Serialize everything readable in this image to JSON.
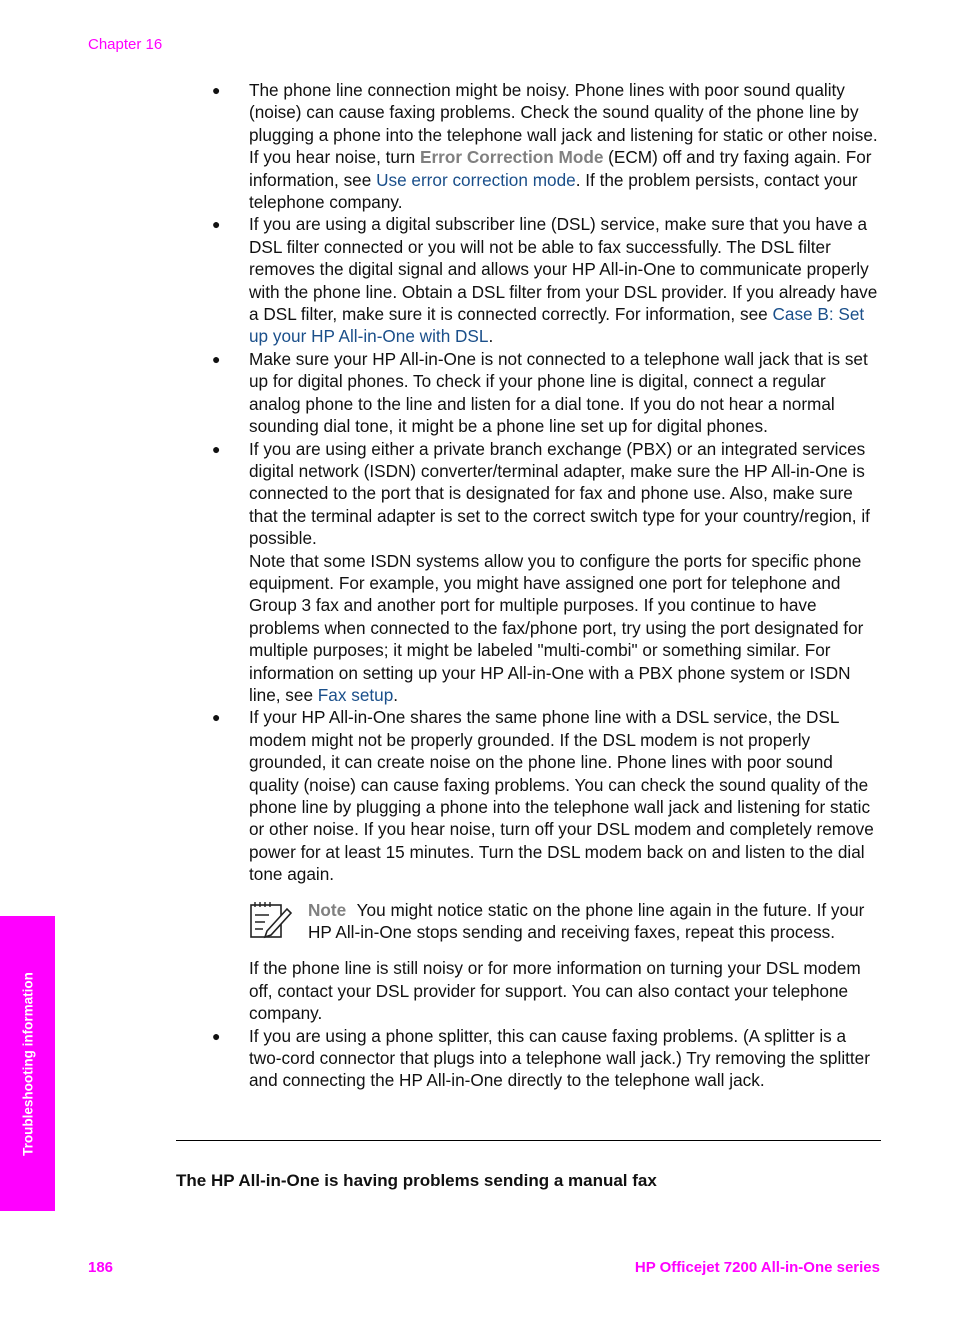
{
  "header": {
    "chapter": "Chapter 16"
  },
  "bullets": [
    {
      "pre": "The phone line connection might be noisy. Phone lines with poor sound quality (noise) can cause faxing problems. Check the sound quality of the phone line by plugging a phone into the telephone wall jack and listening for static or other noise. If you hear noise, turn ",
      "ui_term": "Error Correction Mode",
      "mid": " (ECM) off and try faxing again. For information, see ",
      "link": "Use error correction mode",
      "post": ". If the problem persists, contact your telephone company."
    },
    {
      "pre": "If you are using a digital subscriber line (DSL) service, make sure that you have a DSL filter connected or you will not be able to fax successfully. The DSL filter removes the digital signal and allows your HP All-in-One to communicate properly with the phone line. Obtain a DSL filter from your DSL provider. If you already have a DSL filter, make sure it is connected correctly. For information, see ",
      "link": "Case B: Set up your HP All-in-One with DSL",
      "post": "."
    },
    {
      "text": "Make sure your HP All-in-One is not connected to a telephone wall jack that is set up for digital phones. To check if your phone line is digital, connect a regular analog phone to the line and listen for a dial tone. If you do not hear a normal sounding dial tone, it might be a phone line set up for digital phones."
    },
    {
      "text": "If you are using either a private branch exchange (PBX) or an integrated services digital network (ISDN) converter/terminal adapter, make sure the HP All-in-One is connected to the port that is designated for fax and phone use. Also, make sure that the terminal adapter is set to the correct switch type for your country/region, if possible.",
      "para2_pre": "Note that some ISDN systems allow you to configure the ports for specific phone equipment. For example, you might have assigned one port for telephone and Group 3 fax and another port for multiple purposes. If you continue to have problems when connected to the fax/phone port, try using the port designated for multiple purposes; it might be labeled \"multi-combi\" or something similar. For information on setting up your HP All-in-One with a PBX phone system or ISDN line, see ",
      "link": "Fax setup",
      "post": "."
    },
    {
      "text": "If your HP All-in-One shares the same phone line with a DSL service, the DSL modem might not be properly grounded. If the DSL modem is not properly grounded, it can create noise on the phone line. Phone lines with poor sound quality (noise) can cause faxing problems. You can check the sound quality of the phone line by plugging a phone into the telephone wall jack and listening for static or other noise. If you hear noise, turn off your DSL modem and completely remove power for at least 15 minutes. Turn the DSL modem back on and listen to the dial tone again.",
      "note_label": "Note",
      "note_text": "You might notice static on the phone line again in the future. If your HP All-in-One stops sending and receiving faxes, repeat this process.",
      "after_note": "If the phone line is still noisy or for more information on turning your DSL modem off, contact your DSL provider for support. You can also contact your telephone company."
    },
    {
      "text": "If you are using a phone splitter, this can cause faxing problems. (A splitter is a two-cord connector that plugs into a telephone wall jack.) Try removing the splitter and connecting the HP All-in-One directly to the telephone wall jack."
    }
  ],
  "bullet_glyph": "●",
  "section_heading": "The HP All-in-One is having problems sending a manual fax",
  "side_tab": "Troubleshooting information",
  "footer": {
    "page_number": "186",
    "product": "HP Officejet 7200 All-in-One series"
  }
}
